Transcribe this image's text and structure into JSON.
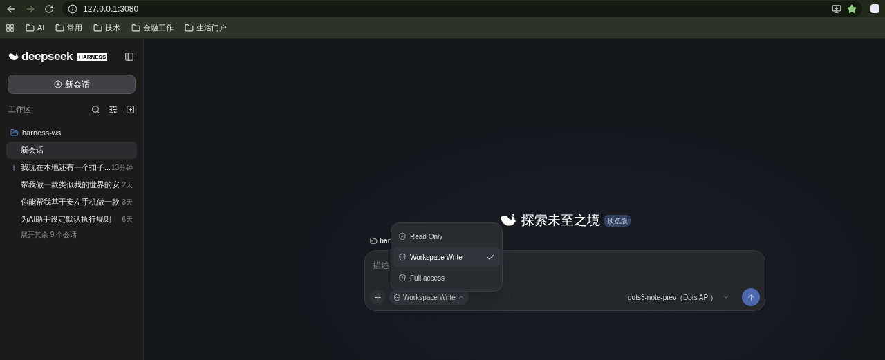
{
  "browser": {
    "url": "127.0.0.1:3080",
    "bookmarks": [
      "AI",
      "常用",
      "技术",
      "金融工作",
      "生活门户"
    ],
    "starred": true
  },
  "sidebar": {
    "brand": "deepseek",
    "brand_badge": "HARNESS",
    "new_chat": "新会话",
    "section": "工作区",
    "workspace": "harness-ws",
    "chats": [
      {
        "title": "新会话",
        "selected": true,
        "busy": false
      },
      {
        "title": "我现在本地还有一个扣子...",
        "time": "13分钟",
        "selected": false,
        "busy": true
      },
      {
        "title": "帮我做一款类似我的世界的安",
        "time": "2天",
        "selected": false,
        "busy": false
      },
      {
        "title": "你能帮我基于安左手机做一款",
        "time": "3天",
        "selected": false,
        "busy": false
      },
      {
        "title": "为AI助手设定默认执行规则",
        "time": "6天",
        "selected": false,
        "busy": false
      }
    ],
    "more": "展开其余 9 个会话"
  },
  "main": {
    "title": "探索未至之境",
    "badge": "预览版",
    "workspace_chip": "har",
    "placeholder": "描述",
    "permission": {
      "label": "Workspace Write",
      "kind": "write",
      "open": true
    },
    "menu": [
      {
        "label": "Read Only",
        "kind": "read",
        "selected": false
      },
      {
        "label": "Workspace Write",
        "kind": "write",
        "selected": true
      },
      {
        "label": "Full access",
        "kind": "full",
        "selected": false
      }
    ],
    "model": "dots3-note-prev（Dots API）"
  }
}
